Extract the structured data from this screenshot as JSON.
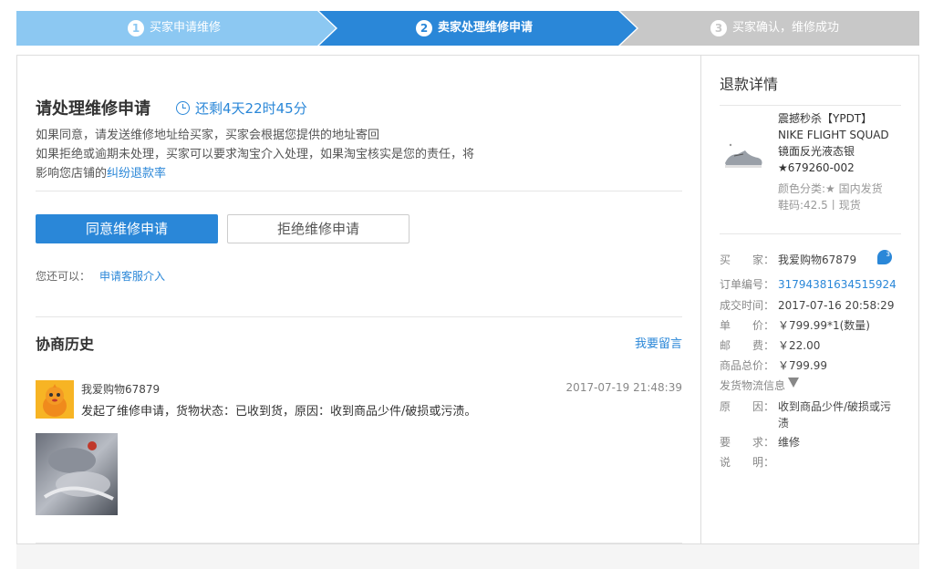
{
  "steps": [
    {
      "num": "1",
      "label": "买家申请维修"
    },
    {
      "num": "2",
      "label": "卖家处理维修申请"
    },
    {
      "num": "3",
      "label": "买家确认，维修成功"
    }
  ],
  "colors": {
    "step_done": "#8cc8f2",
    "step_active": "#2a87d8",
    "step_pending": "#c8c8c8",
    "accent": "#2a87d8"
  },
  "main": {
    "title": "请处理维修申请",
    "countdown": "还剩4天22时45分",
    "desc_line1": "如果同意，请发送维修地址给买家，买家会根据您提供的地址寄回",
    "desc_line2": "如果拒绝或逾期未处理，买家可以要求淘宝介入处理，如果淘宝核实是您的责任，将",
    "desc_line3_prefix": "影响您店铺的",
    "desc_link": "纠纷退款率",
    "agree_label": "同意维修申请",
    "reject_label": "拒绝维修申请",
    "also_label": "您还可以：",
    "service_link": "申请客服介入"
  },
  "history": {
    "title": "协商历史",
    "leave_message": "我要留言",
    "message": {
      "user": "我爱购物67879",
      "time": "2017-07-19 21:48:39",
      "text": "发起了维修申请，货物状态：已收到货，原因：收到商品少件/破损或污渍。"
    }
  },
  "refund_detail": {
    "title": "退款详情",
    "product_name_lines": [
      "震撼秒杀【YPDT】",
      "NIKE FLIGHT SQUAD",
      "镜面反光液态银",
      "★679260-002"
    ],
    "sku_lines": [
      "颜色分类:★ 国内发货",
      "鞋码:42.5丨现货"
    ],
    "buyer_label": "买　　家：",
    "buyer": "我爱购物67879",
    "order_label": "订单编号：",
    "order_no": "31794381634515924",
    "deal_time_label": "成交时间：",
    "deal_time": "2017-07-16 20:58:29",
    "price_label": "单　　价：",
    "price": "￥799.99*1(数量)",
    "postage_label": "邮　　费：",
    "postage": "￥22.00",
    "total_label": "商品总价：",
    "total": "￥799.99",
    "shipping_info": "发货物流信息",
    "reason_label": "原　　因：",
    "reason": "收到商品少件/破损或污渍",
    "request_label": "要　　求：",
    "request": "维修",
    "note_label": "说　　明：",
    "note": ""
  }
}
